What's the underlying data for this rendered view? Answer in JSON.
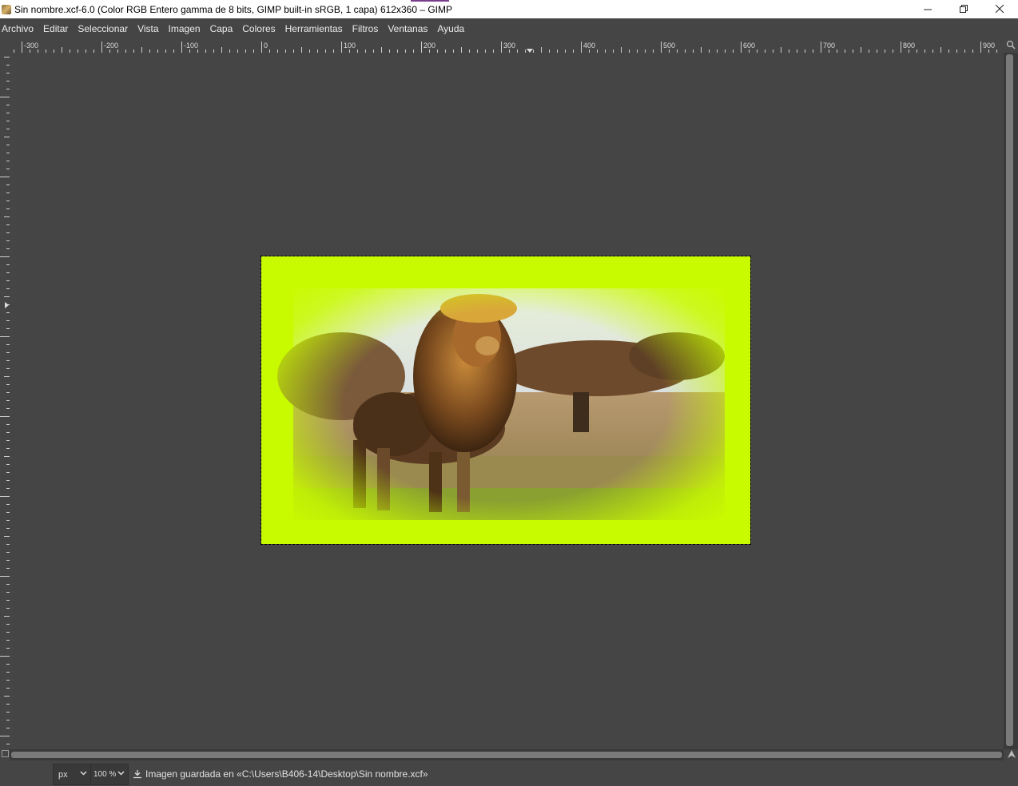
{
  "window": {
    "title": "Sin nombre.xcf-6.0 (Color RGB Entero gamma de 8 bits, GIMP built-in sRGB, 1 capa) 612x360 – GIMP",
    "app_icon": "gimp-icon",
    "controls": {
      "minimize": "—",
      "maximize": "❐",
      "close": "✕"
    }
  },
  "menubar": {
    "items": [
      "Archivo",
      "Editar",
      "Seleccionar",
      "Vista",
      "Imagen",
      "Capa",
      "Colores",
      "Herramientas",
      "Filtros",
      "Ventanas",
      "Ayuda"
    ]
  },
  "ruler_h": {
    "labels": [
      "-300",
      "-200",
      "-100",
      "0",
      "100",
      "200",
      "300",
      "400",
      "500",
      "600",
      "700",
      "800",
      "900"
    ]
  },
  "ruler_v": {
    "labels": [
      "-200",
      "-100",
      "0",
      "100",
      "200",
      "300",
      "400",
      "500",
      "600"
    ]
  },
  "canvas": {
    "image_description_icon": "lion-photo",
    "background_color": "#c9fb00",
    "canvas_color": "#454545"
  },
  "statusbar": {
    "unit": "px",
    "zoom": "100 %",
    "message": "Imagen guardada en «C:\\Users\\B406-14\\Desktop\\Sin nombre.xcf»"
  },
  "icons": {
    "navigate": "navigate-icon",
    "zoom_toggle": "magnifier-icon",
    "quick_mask": "quick-mask-icon"
  }
}
